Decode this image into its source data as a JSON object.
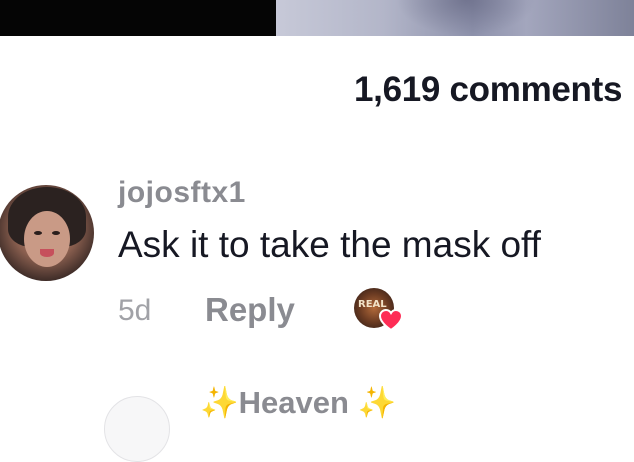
{
  "header": {
    "comment_count": "1,619 comments"
  },
  "comment": {
    "username": "jojosftx1",
    "text": "Ask it to take the mask off",
    "age": "5d",
    "reply_label": "Reply",
    "creator_liked": true,
    "creator_avatar_text": "REAL"
  },
  "next_comment": {
    "username_text": "Heaven",
    "decoration": "✨"
  },
  "colors": {
    "primary_text": "#161823",
    "secondary_text": "#8a8b91",
    "heart": "#fe2c55"
  },
  "icons": {
    "like_badge": "heart-icon"
  }
}
